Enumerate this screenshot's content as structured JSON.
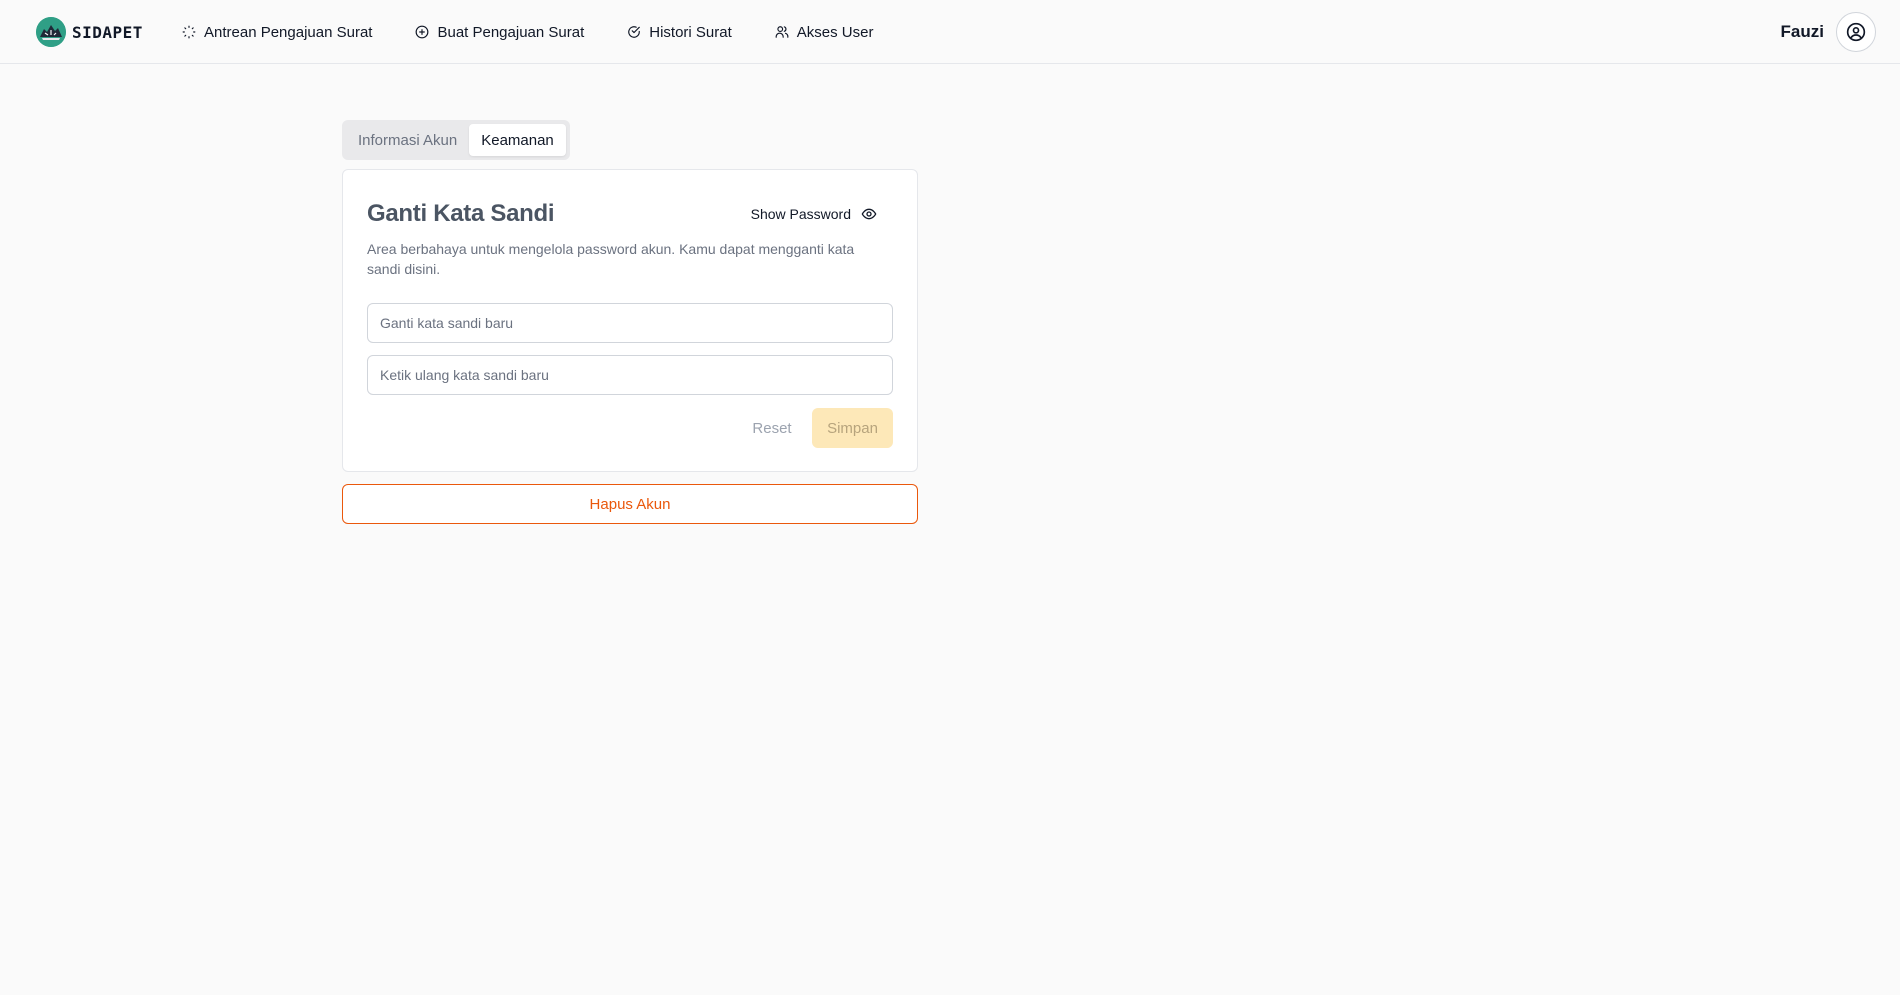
{
  "brand": {
    "name": "SIDAPET",
    "logo_icon": "brand-logo-icon"
  },
  "nav": {
    "items": [
      {
        "label": "Antrean Pengajuan Surat",
        "icon": "loader-circle-icon"
      },
      {
        "label": "Buat Pengajuan Surat",
        "icon": "plus-circle-icon"
      },
      {
        "label": "Histori Surat",
        "icon": "check-circle-icon"
      },
      {
        "label": "Akses User",
        "icon": "users-icon"
      }
    ]
  },
  "user": {
    "name": "Fauzi",
    "icon": "user-circle-icon"
  },
  "tabs": [
    {
      "label": "Informasi Akun",
      "active": false
    },
    {
      "label": "Keamanan",
      "active": true
    }
  ],
  "card": {
    "title": "Ganti Kata Sandi",
    "show_password_label": "Show Password",
    "show_password_icon": "eye-icon",
    "description": "Area berbahaya untuk mengelola password akun. Kamu dapat mengganti kata sandi disini.",
    "new_password": {
      "value": "",
      "placeholder": "Ganti kata sandi baru"
    },
    "repeat_password": {
      "value": "",
      "placeholder": "Ketik ulang kata sandi baru"
    },
    "reset_label": "Reset",
    "save_label": "Simpan"
  },
  "delete_account_label": "Hapus Akun",
  "colors": {
    "brand_teal": "#2f9f86",
    "danger": "#ea580c",
    "save_disabled_bg": "#fde8b8",
    "page_bg": "#fafafa"
  }
}
